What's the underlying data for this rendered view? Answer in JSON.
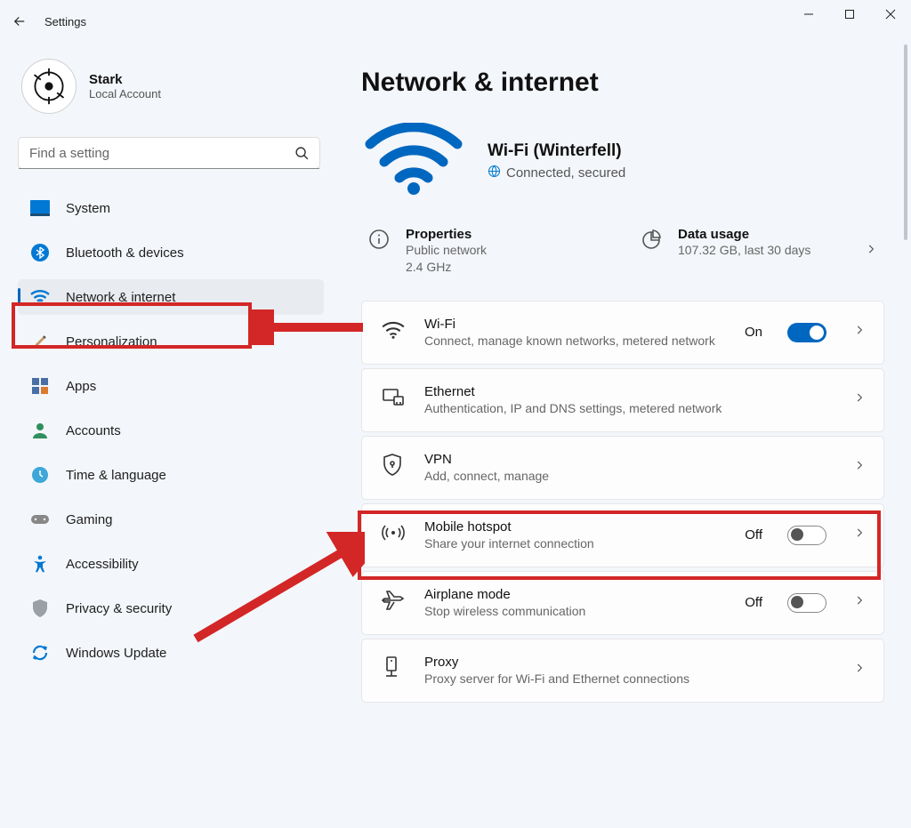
{
  "app": {
    "title": "Settings"
  },
  "user": {
    "name": "Stark",
    "account_type": "Local Account"
  },
  "search": {
    "placeholder": "Find a setting"
  },
  "sidebar": {
    "active_index": 2,
    "items": [
      {
        "label": "System"
      },
      {
        "label": "Bluetooth & devices"
      },
      {
        "label": "Network & internet"
      },
      {
        "label": "Personalization"
      },
      {
        "label": "Apps"
      },
      {
        "label": "Accounts"
      },
      {
        "label": "Time & language"
      },
      {
        "label": "Gaming"
      },
      {
        "label": "Accessibility"
      },
      {
        "label": "Privacy & security"
      },
      {
        "label": "Windows Update"
      }
    ]
  },
  "page": {
    "heading": "Network & internet",
    "connection": {
      "ssid_label": "Wi-Fi (Winterfell)",
      "status": "Connected, secured"
    },
    "quick": {
      "properties": {
        "title": "Properties",
        "line1": "Public network",
        "line2": "2.4 GHz"
      },
      "data_usage": {
        "title": "Data usage",
        "line1": "107.32 GB, last 30 days"
      }
    },
    "cards": [
      {
        "id": "wifi",
        "title": "Wi-Fi",
        "sub": "Connect, manage known networks, metered network",
        "state_label": "On",
        "toggle": "on"
      },
      {
        "id": "ethernet",
        "title": "Ethernet",
        "sub": "Authentication, IP and DNS settings, metered network"
      },
      {
        "id": "vpn",
        "title": "VPN",
        "sub": "Add, connect, manage"
      },
      {
        "id": "hotspot",
        "title": "Mobile hotspot",
        "sub": "Share your internet connection",
        "state_label": "Off",
        "toggle": "off"
      },
      {
        "id": "airplane",
        "title": "Airplane mode",
        "sub": "Stop wireless communication",
        "state_label": "Off",
        "toggle": "off"
      },
      {
        "id": "proxy",
        "title": "Proxy",
        "sub": "Proxy server for Wi-Fi and Ethernet connections"
      }
    ]
  }
}
